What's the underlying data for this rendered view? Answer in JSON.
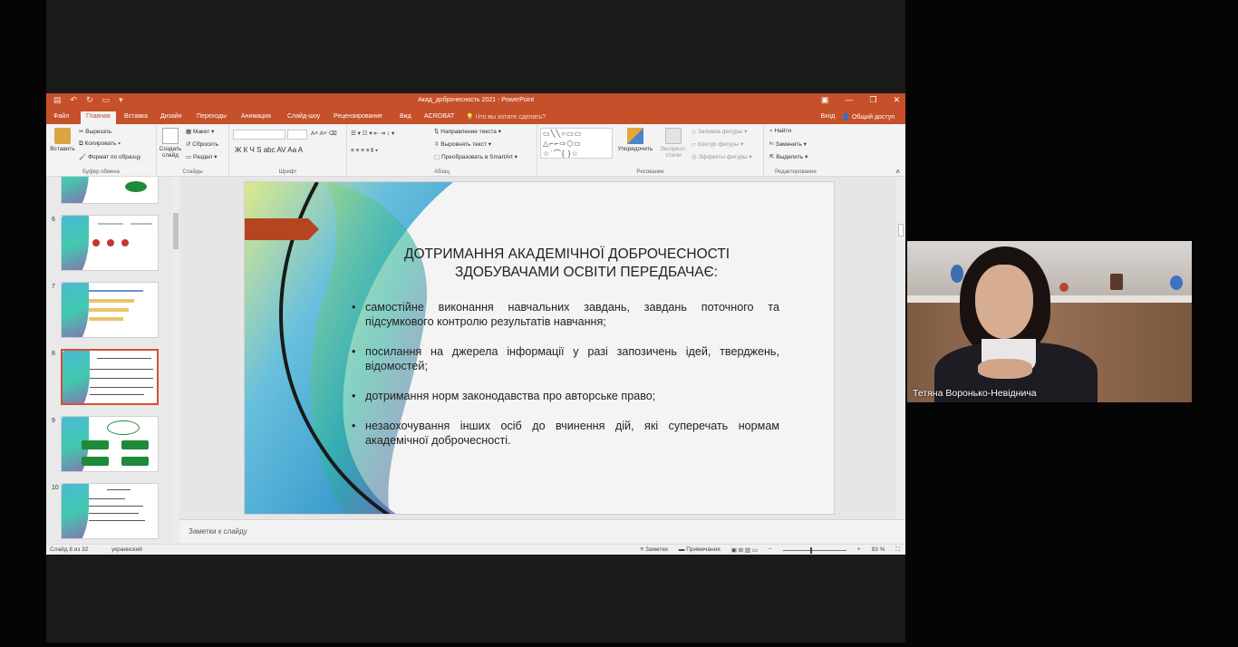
{
  "window": {
    "title": "Акад_доброчесность 2021 - PowerPoint",
    "controls": [
      "▣",
      "—",
      "❐",
      "✕"
    ]
  },
  "menu": {
    "tabs": [
      "Файл",
      "Главная",
      "Вставка",
      "Дизайн",
      "Переходы",
      "Анимация",
      "Слайд-шоу",
      "Рецензирование",
      "Вид",
      "ACROBAT"
    ],
    "active": "Главная",
    "search_placeholder": "Что вы хотите сделать?",
    "login": "Вход",
    "share": "Общий доступ"
  },
  "ribbon": {
    "clipboard": {
      "paste": "Вставить",
      "cut": "Вырезать",
      "copy": "Копировать",
      "format_painter": "Формат по образцу",
      "label": "Буфер обмена"
    },
    "slides": {
      "new_slide": "Создать слайд",
      "layout": "Макет",
      "reset": "Сбросить",
      "section": "Раздел",
      "label": "Слайды"
    },
    "font": {
      "bold": "Ж",
      "italic": "К",
      "underline": "Ч",
      "strike": "S",
      "label": "Шрифт"
    },
    "paragraph": {
      "text_direction": "Направление текста",
      "align_text": "Выровнять текст",
      "smartart": "Преобразовать в SmartArt",
      "label": "Абзац"
    },
    "drawing": {
      "arrange": "Упорядочить",
      "quick_styles": "Экспресс-стили",
      "fill": "Заливка фигуры",
      "outline": "Контур фигуры",
      "effects": "Эффекты фигуры",
      "label": "Рисование"
    },
    "editing": {
      "find": "Найти",
      "replace": "Заменить",
      "select": "Выделить",
      "label": "Редактирование"
    }
  },
  "thumbnails": [
    {
      "num": "",
      "selected": false
    },
    {
      "num": "6",
      "selected": false
    },
    {
      "num": "7",
      "selected": false
    },
    {
      "num": "8",
      "selected": true
    },
    {
      "num": "9",
      "selected": false
    },
    {
      "num": "10",
      "selected": false
    }
  ],
  "slide": {
    "title_line1": "ДОТРИМАННЯ АКАДЕМІЧНОЇ ДОБРОЧЕСНОСТІ",
    "title_line2": "ЗДОБУВАЧАМИ ОСВІТИ ПЕРЕДБАЧАЄ:",
    "bullets": [
      "самостійне виконання навчальних завдань, завдань поточного та підсумкового контролю результатів навчання;",
      "посилання на джерела інформації у разі запозичень ідей, тверджень, відомостей;",
      "дотримання норм законодавства про авторське право;",
      "незаохочування інших осіб до вчинення дій, які суперечать нормам академічної доброчесності."
    ],
    "bullet_glyph": "•"
  },
  "notes": {
    "placeholder": "Заметки к слайду"
  },
  "status": {
    "slide_info": "Слайд 8 из 32",
    "language": "украинский",
    "notes_btn": "Заметки",
    "comments_btn": "Примечания",
    "zoom": "83 %"
  },
  "video": {
    "participant_name": "Тетяна Воронько-Невіднича"
  },
  "colors": {
    "accent": "#c6502a",
    "ribbon_bg": "#f3f3f3",
    "selection": "#d35230"
  }
}
